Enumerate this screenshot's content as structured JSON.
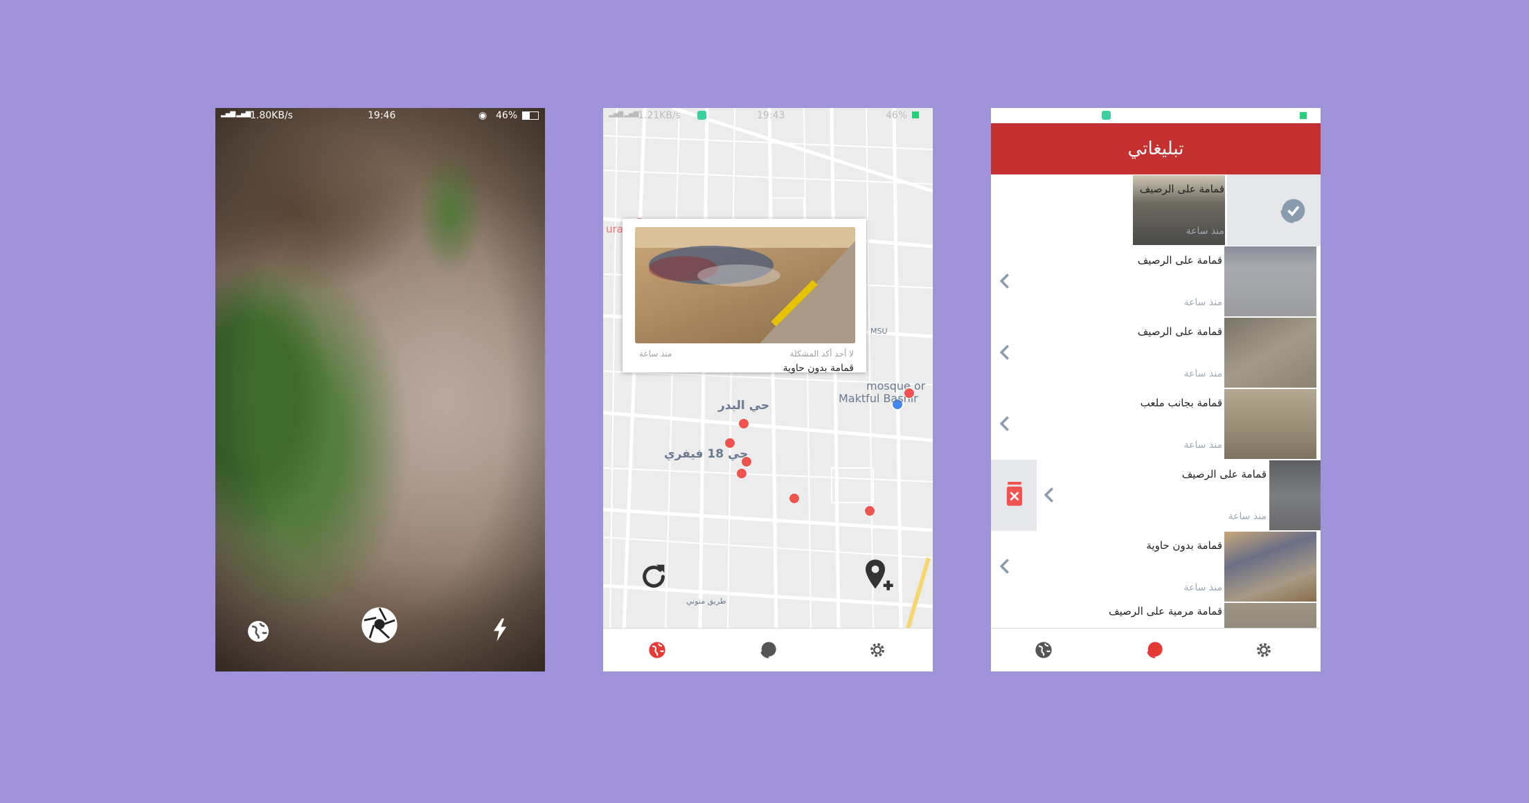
{
  "camera": {
    "status": {
      "net": "1.80KB/s",
      "time": "19:46",
      "battery": "46%"
    },
    "controls": [
      {
        "name": "globe-icon"
      },
      {
        "name": "shutter-icon"
      },
      {
        "name": "flash-icon"
      }
    ]
  },
  "map": {
    "status": {
      "net": "1.21KB/s",
      "time": "19:43",
      "battery": "46%"
    },
    "labels": {
      "hay_badr": "حي البدر",
      "hay_18": "حي 18 فيفري",
      "mosque": "mosque or",
      "mosque2": "Maktful Bashir",
      "road": "طريق متوني",
      "urab": "urab",
      "msu": "MSU"
    },
    "popup": {
      "nobody_confirmed": "لا أحد أكد المشكلة",
      "time": "منذ ساعة",
      "title": "قمامة بدون حاوية"
    },
    "nav": [
      {
        "name": "globe-icon",
        "color": "#e53935"
      },
      {
        "name": "reports-icon",
        "color": "#555555"
      },
      {
        "name": "settings-icon",
        "color": "#555555"
      }
    ]
  },
  "reports": {
    "title": "تبليغاتي",
    "items": [
      {
        "title": "قمامة على الرصيف",
        "time": "منذ ساعة"
      },
      {
        "title": "قمامة على الرصيف",
        "time": "منذ ساعة"
      },
      {
        "title": "قمامة على الرصيف",
        "time": "منذ ساعة"
      },
      {
        "title": "قمامة بجانب ملعب",
        "time": "منذ ساعة"
      },
      {
        "title": "قمامة على الرصيف",
        "time": "منذ ساعة"
      },
      {
        "title": "قمامة بدون حاوية",
        "time": "منذ ساعة"
      },
      {
        "title": "قمامة مرمية على الرصيف",
        "time": ""
      }
    ],
    "nav": [
      {
        "name": "globe-icon",
        "color": "#555555"
      },
      {
        "name": "reports-icon",
        "color": "#e53935"
      },
      {
        "name": "settings-icon",
        "color": "#555555"
      }
    ],
    "accent": "#c53030"
  }
}
